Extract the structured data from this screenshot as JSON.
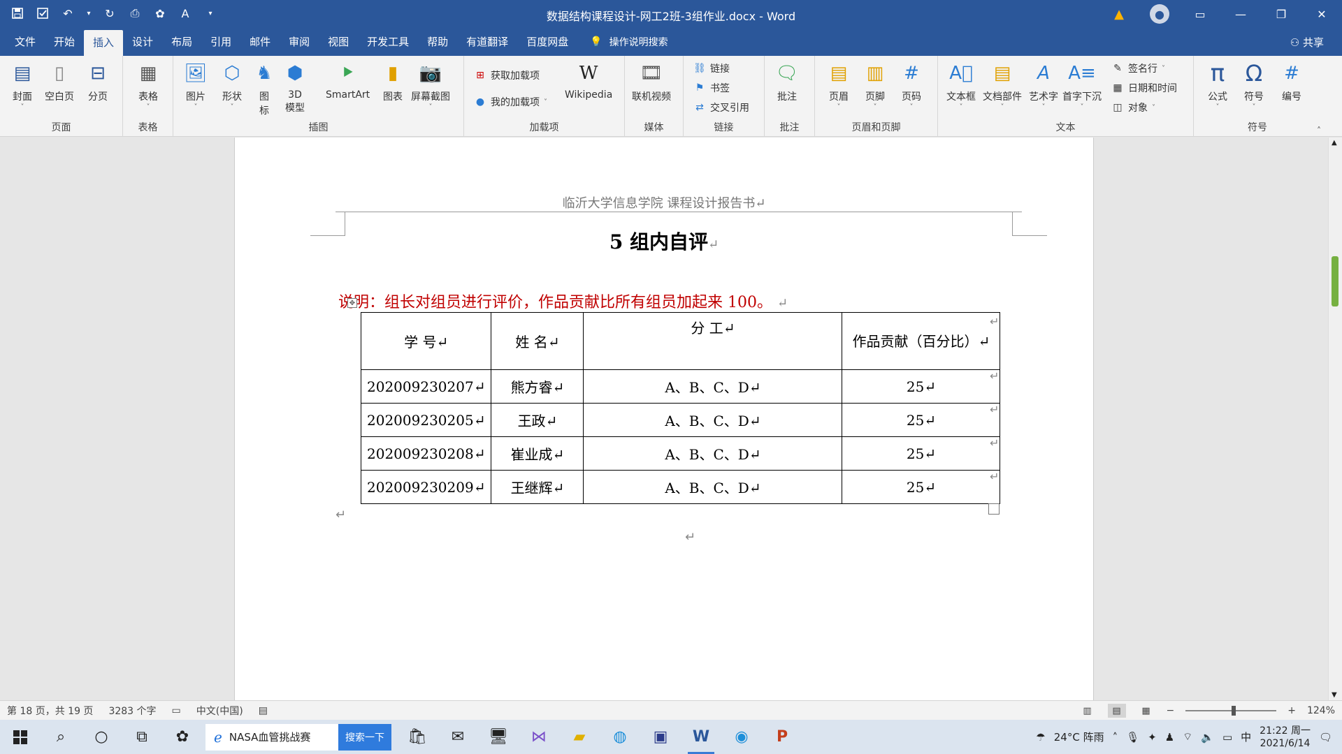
{
  "window": {
    "title": "数据结构课程设计-网工2班-3组作业.docx - Word",
    "share_label": "共享"
  },
  "qat": {
    "save": "save-icon",
    "autosave": "checkbox-icon",
    "undo": "undo-icon",
    "redo": "redo-icon",
    "preview": "print-preview-icon",
    "customize": "customize-icon"
  },
  "tabs": [
    "文件",
    "开始",
    "插入",
    "设计",
    "布局",
    "引用",
    "邮件",
    "审阅",
    "视图",
    "开发工具",
    "帮助",
    "有道翻译",
    "百度网盘"
  ],
  "active_tab": "插入",
  "tell_me": "操作说明搜索",
  "ribbon": {
    "groups": {
      "pages": "页面",
      "tables": "表格",
      "illustrations": "插图",
      "addins": "加载项",
      "media": "媒体",
      "links": "链接",
      "comments": "批注",
      "header_footer": "页眉和页脚",
      "text": "文本",
      "symbols": "符号"
    },
    "buttons": {
      "cover": "封面",
      "blank": "空白页",
      "break": "分页",
      "table": "表格",
      "picture": "图片",
      "shapes": "形状",
      "icons_1": "图",
      "icons_2": "标",
      "model_1": "3D",
      "model_2": "模型",
      "smartart": "SmartArt",
      "chart": "图表",
      "screenshot": "屏幕截图",
      "get_addins": "获取加载项",
      "my_addins": "我的加载项",
      "wikipedia": "Wikipedia",
      "online_video": "联机视频",
      "link": "链接",
      "bookmark": "书签",
      "crossref": "交叉引用",
      "comment": "批注",
      "header": "页眉",
      "footer": "页脚",
      "page_number": "页码",
      "textbox": "文本框",
      "quickparts": "文档部件",
      "wordart": "艺术字",
      "dropcap": "首字下沉",
      "signature": "签名行",
      "datetime": "日期和时间",
      "object": "对象",
      "equation": "公式",
      "symbol": "符号",
      "number": "编号"
    }
  },
  "document": {
    "header_text": "临沂大学信息学院  课程设计报告书↵",
    "heading": "5 组内自评",
    "note": "说明：组长对组员进行评价，作品贡献比所有组员加起来 100。",
    "table": {
      "headers": [
        "学  号↵",
        "姓  名↵",
        "分  工↵",
        "作品贡献（百分比）↵"
      ],
      "rows": [
        [
          "202009230207↵",
          "熊方睿↵",
          "A、B、C、D↵",
          "25↵"
        ],
        [
          "202009230205↵",
          "王政↵",
          "A、B、C、D↵",
          "25↵"
        ],
        [
          "202009230208↵",
          "崔业成↵",
          "A、B、C、D↵",
          "25↵"
        ],
        [
          "202009230209↵",
          "王继辉↵",
          "A、B、C、D↵",
          "25↵"
        ]
      ]
    },
    "para_mark": "↵"
  },
  "statusbar": {
    "page": "第 18 页，共 19 页",
    "words": "3283 个字",
    "language": "中文(中国)",
    "zoom": "124%"
  },
  "taskbar": {
    "search_text": "NASA血管挑战赛",
    "search_button": "搜索一下",
    "weather": "24°C  阵雨",
    "ime": "中",
    "time": "21:22 周一",
    "date": "2021/6/14"
  }
}
